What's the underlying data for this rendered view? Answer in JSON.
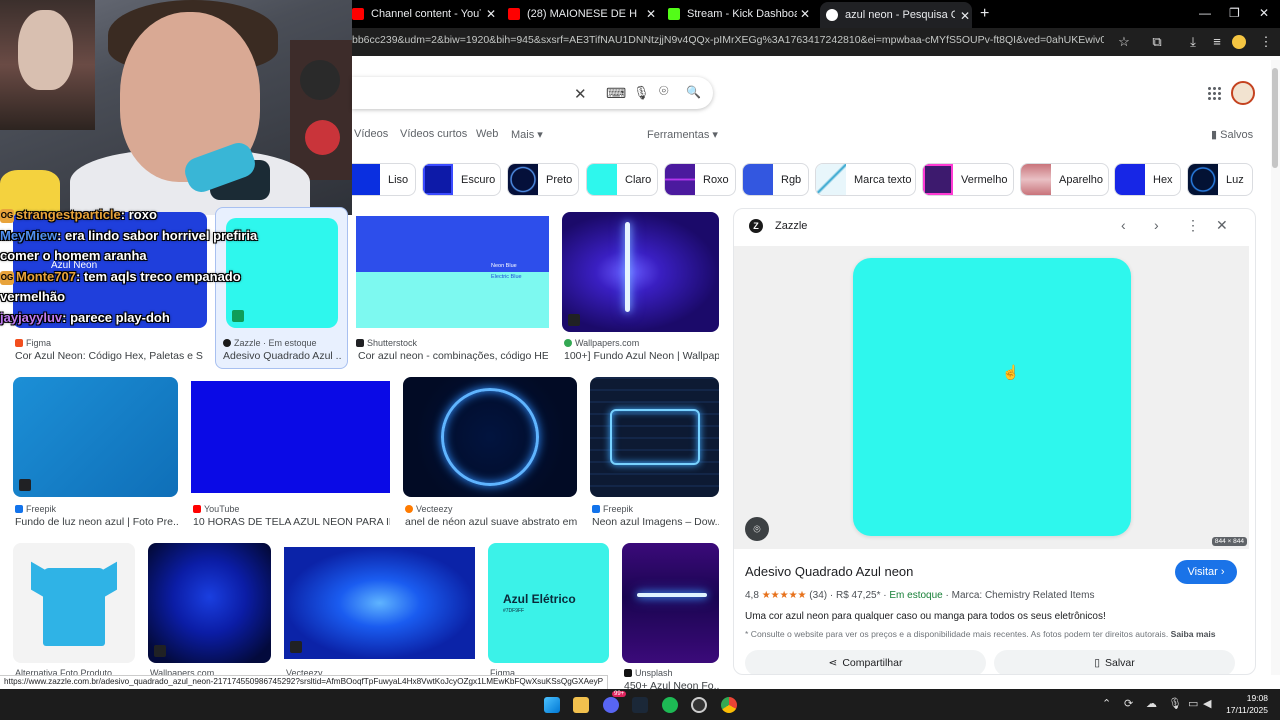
{
  "browser": {
    "tabs": [
      {
        "title": "Channel content - YouTube Stu",
        "color": "#ff0000"
      },
      {
        "title": "(28) MAIONESE DE HALLOWEE",
        "color": "#ff0000"
      },
      {
        "title": "Stream - Kick Dashboard",
        "color": "#53fc18"
      },
      {
        "title": "azul neon - Pesquisa Google",
        "color": "#ffffff"
      }
    ],
    "tab_close": "✕",
    "new_tab": "+",
    "url": "bb6cc239&udm=2&biw=1920&bih=945&sxsrf=AE3TifNAU1DNNtzjjN9v4QQx-pIMrXEGg%3A1763417242810&ei=mpwbaa-cMYfS5OUPv-ft8QI&ved=0ahUKEwiv0eS5mfqQAxUHKbk...",
    "window": {
      "minimize": "—",
      "maximize": "❐",
      "close": "✕"
    }
  },
  "chat": [
    {
      "user": "strangestparticle",
      "msg": "roxo",
      "color": "#e8a33b",
      "badge": true
    },
    {
      "user": "MeyMiew",
      "msg": "era lindo sabor horrivel prefiria comer o homem aranha",
      "color": "#2f6fd6",
      "badge": false
    },
    {
      "user": "Monte707",
      "msg": "tem aqls treco empanado vermelhão",
      "color": "#e8a33b",
      "badge": true
    },
    {
      "user": "jayjayyluv",
      "msg": "parece play-doh",
      "color": "#b05ce6",
      "badge": false
    }
  ],
  "chat_badge": "OG",
  "search": {
    "clear": "✕",
    "keyboard": "⌨",
    "mic": "🎙",
    "lens": "⌾",
    "search": "🔍"
  },
  "nav": {
    "items": [
      "Vídeos",
      "Vídeos curtos",
      "Web",
      "Mais"
    ],
    "tools": "Ferramentas",
    "saved": "Salvos"
  },
  "chips": [
    {
      "label": "Liso",
      "color": "#0a2fe0"
    },
    {
      "label": "Escuro",
      "color": "#0d1aa8"
    },
    {
      "label": "Preto",
      "color": "#05103a"
    },
    {
      "label": "Claro",
      "color": "#2ef7ed"
    },
    {
      "label": "Roxo",
      "color": "#4b1a9e"
    },
    {
      "label": "Rgb",
      "color": "#3357e0"
    },
    {
      "label": "Marca texto",
      "color": "#e8f6fb"
    },
    {
      "label": "Vermelho",
      "color": "#3d1a6e"
    },
    {
      "label": "Aparelho",
      "color": "#c9747b"
    },
    {
      "label": "Hex",
      "color": "#1726e6"
    },
    {
      "label": "Luz",
      "color": "#031234"
    }
  ],
  "results": [
    {
      "source": "Figma",
      "title": "Cor Azul Neon: Código Hex, Paletas e Si...",
      "src_color": "#f24e1e",
      "img_text": "Azul Neon"
    },
    {
      "source": "Zazzle · Em estoque",
      "title": "Adesivo Quadrado Azul ...",
      "src_color": "#1a1a1a"
    },
    {
      "source": "Shutterstock",
      "title": "Cor azul neon - combinações, código HE...",
      "src_color": "#202124",
      "img_text": "Neon Blue",
      "img_text2": "Electric Blue"
    },
    {
      "source": "Wallpapers.com",
      "title": "100+] Fundo Azul Neon | Wallpap...",
      "src_color": "#34a853"
    },
    {
      "source": "Freepik",
      "title": "Fundo de luz neon azul | Foto Pre...",
      "src_color": "#1273eb"
    },
    {
      "source": "YouTube",
      "title": "10 HORAS DE TELA AZUL NEON PARA IL...",
      "src_color": "#ff0000"
    },
    {
      "source": "Vecteezy",
      "title": "anel de néon azul suave abstrato em...",
      "src_color": "#ff7b00"
    },
    {
      "source": "Freepik",
      "title": "Neon azul Imagens – Dow...",
      "src_color": "#1273eb"
    },
    {
      "source": "Alternativa Foto Produto",
      "title": ""
    },
    {
      "source": "Wallpapers.com",
      "title": ""
    },
    {
      "source": "Vecteezy",
      "title": ""
    },
    {
      "source": "Figma",
      "title": "",
      "img_text": "Azul Elétrico",
      "img_sub": "#7DF9FF"
    },
    {
      "source": "Unsplash",
      "title": "450+ Azul Neon Fo..."
    }
  ],
  "preview": {
    "site": "Zazzle",
    "dims": "844 × 844",
    "title": "Adesivo Quadrado Azul neon",
    "visit": "Visitar",
    "rating": "4,8",
    "stars": "★★★★★",
    "reviews": "(34)",
    "price": "R$ 47,25*",
    "stock": "Em estoque",
    "brand": "Marca: Chemistry Related Items",
    "description": "Uma cor azul neon para qualquer caso ou manga para todos os seus eletrônicos!",
    "note": "* Consulte o website para ver os preços e a disponibilidade mais recentes. As fotos podem ter direitos autorais.",
    "note_more": "Saiba mais",
    "share": "Compartilhar",
    "save": "Salvar",
    "swatch_color": "#2ef7ed"
  },
  "status_url": "https://www.zazzle.com.br/adesivo_quadrado_azul_neon-217174550986745292?srsltid=AfmBOoqfTpFuwyaL4Hx8VwtKoJcyOZgx1LMEwKbFQwXsuKSsQgGXAeyP",
  "taskbar": {
    "time": "19:08",
    "date": "17/11/2025",
    "discord_badge": "99+"
  }
}
